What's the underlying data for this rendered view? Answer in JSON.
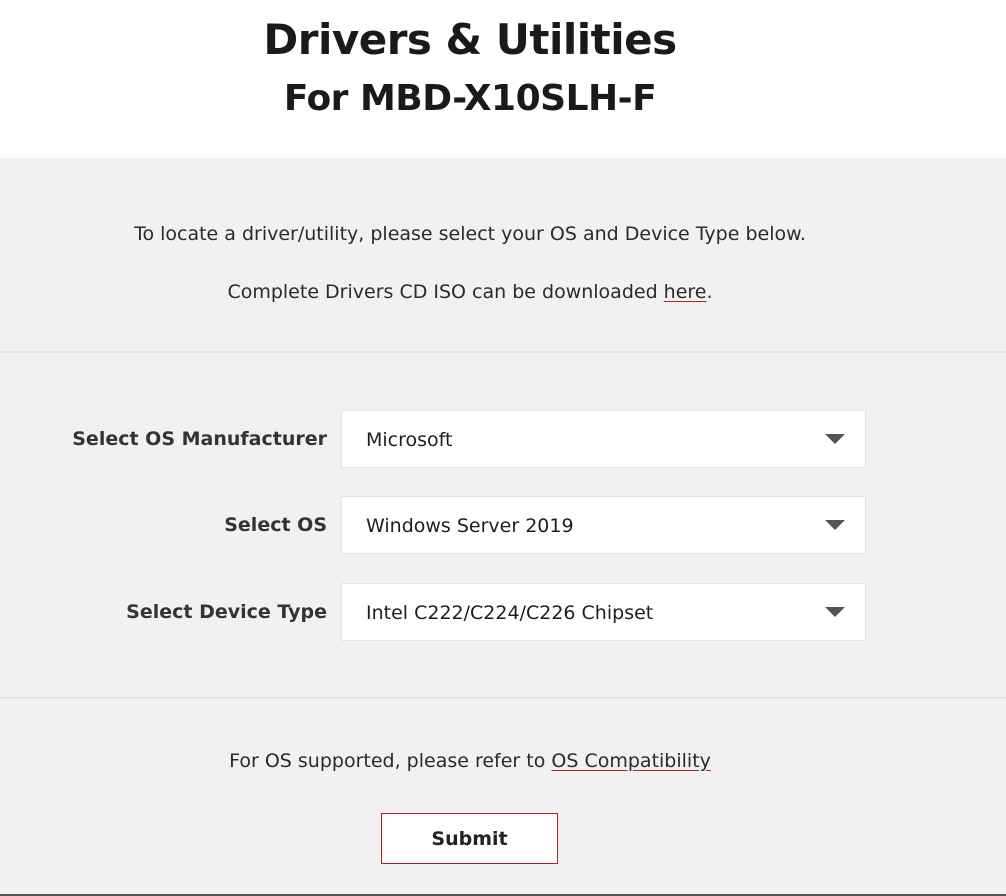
{
  "header": {
    "title": "Drivers & Utilities",
    "subtitle": "For MBD-X10SLH-F"
  },
  "intro": {
    "locate_text": "To locate a driver/utility, please select your OS and Device Type below.",
    "iso_text_before": "Complete Drivers CD ISO can be downloaded ",
    "iso_link": "here",
    "iso_text_after": "."
  },
  "form": {
    "os_manufacturer": {
      "label": "Select OS Manufacturer",
      "value": "Microsoft"
    },
    "os": {
      "label": "Select OS",
      "value": "Windows Server 2019"
    },
    "device_type": {
      "label": "Select Device Type",
      "value": "Intel C222/C224/C226 Chipset"
    }
  },
  "footer": {
    "os_note_before": "For OS supported, please refer to ",
    "os_note_link": "OS Compatibility",
    "submit_label": "Submit"
  }
}
